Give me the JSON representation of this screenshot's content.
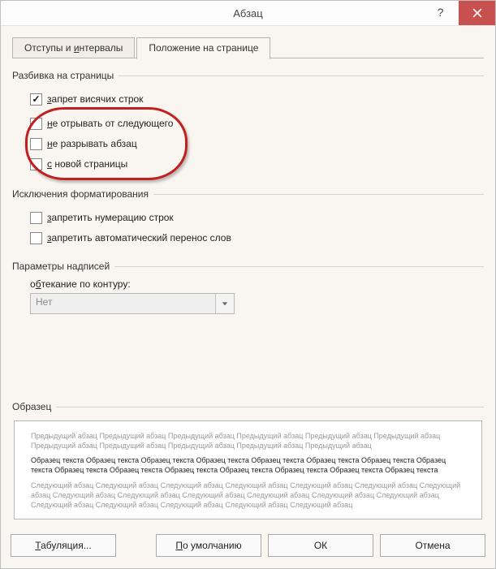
{
  "window": {
    "title": "Абзац"
  },
  "tabs": {
    "indents": {
      "pre": "Отступы и ",
      "hot": "и",
      "post": "нтервалы"
    },
    "position": "Положение на странице"
  },
  "groups": {
    "pagination": {
      "label": "Разбивка на страницы",
      "widow": {
        "hot": "з",
        "rest": "апрет висячих строк"
      },
      "keep_next": {
        "hot": "н",
        "rest": "е отрывать от следующего"
      },
      "keep_lines": {
        "hot": "н",
        "rest": "е разрывать абзац"
      },
      "page_break": {
        "hot": "с",
        "rest": " новой страницы"
      }
    },
    "formatting": {
      "label": "Исключения форматирования",
      "suppress_num": {
        "hot": "з",
        "rest": "апретить нумерацию строк"
      },
      "suppress_hyph": {
        "hot": "з",
        "rest": "апретить автоматический перенос слов"
      }
    },
    "textbox": {
      "label": "Параметры надписей",
      "wrap_label": {
        "pre": "о",
        "hot": "б",
        "post": "текание по контуру:"
      },
      "wrap_value": "Нет"
    },
    "preview": {
      "label": "Образец",
      "prev_para": "Предыдущий абзац Предыдущий абзац Предыдущий абзац Предыдущий абзац Предыдущий абзац Предыдущий абзац Предыдущий абзац Предыдущий абзац Предыдущий абзац Предыдущий абзац Предыдущий абзац",
      "sample": "Образец текста Образец текста Образец текста Образец текста Образец текста Образец текста Образец текста Образец текста Образец текста Образец текста Образец текста Образец текста Образец текста Образец текста Образец текста",
      "next_para": "Следующий абзац Следующий абзац Следующий абзац Следующий абзац Следующий абзац Следующий абзац Следующий абзац Следующий абзац Следующий абзац Следующий абзац Следующий абзац Следующий абзац Следующий абзац Следующий абзац Следующий абзац Следующий абзац Следующий абзац Следующий абзац"
    }
  },
  "buttons": {
    "tabs": {
      "hot": "Т",
      "rest": "абуляция..."
    },
    "default": {
      "hot": "П",
      "rest": "о умолчанию"
    },
    "ok": "ОК",
    "cancel": "Отмена"
  }
}
